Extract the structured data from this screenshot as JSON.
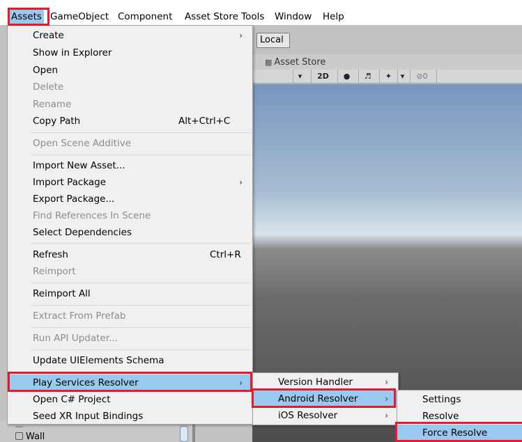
{
  "menubar": {
    "items": [
      "Assets",
      "GameObject",
      "Component",
      "Asset Store Tools",
      "Window",
      "Help"
    ]
  },
  "editor": {
    "local_button": "Local",
    "asset_store_tab": "Asset Store",
    "toolbar": {
      "mode_2d": "2D",
      "hidden_count": "0"
    },
    "hierarchy_item": "Wall"
  },
  "assets_menu": {
    "items": [
      {
        "label": "Create",
        "submenu": true,
        "enabled": true
      },
      {
        "label": "Show in Explorer",
        "enabled": true
      },
      {
        "label": "Open",
        "enabled": true
      },
      {
        "label": "Delete",
        "enabled": false
      },
      {
        "label": "Rename",
        "enabled": false
      },
      {
        "label": "Copy Path",
        "shortcut": "Alt+Ctrl+C",
        "enabled": true
      },
      {
        "label": "Open Scene Additive",
        "enabled": false
      },
      {
        "label": "Import New Asset...",
        "enabled": true
      },
      {
        "label": "Import Package",
        "submenu": true,
        "enabled": true
      },
      {
        "label": "Export Package...",
        "enabled": true
      },
      {
        "label": "Find References In Scene",
        "enabled": false
      },
      {
        "label": "Select Dependencies",
        "enabled": true
      },
      {
        "label": "Refresh",
        "shortcut": "Ctrl+R",
        "enabled": true
      },
      {
        "label": "Reimport",
        "enabled": false
      },
      {
        "label": "Reimport All",
        "enabled": true
      },
      {
        "label": "Extract From Prefab",
        "enabled": false
      },
      {
        "label": "Run API Updater...",
        "enabled": false
      },
      {
        "label": "Update UIElements Schema",
        "enabled": true
      },
      {
        "label": "Play Services Resolver",
        "submenu": true,
        "enabled": true,
        "highlighted": true
      },
      {
        "label": "Open C# Project",
        "enabled": true
      },
      {
        "label": "Seed XR Input Bindings",
        "enabled": true
      }
    ]
  },
  "resolver_menu": {
    "items": [
      {
        "label": "Version Handler",
        "submenu": true
      },
      {
        "label": "Android Resolver",
        "submenu": true,
        "highlighted": true
      },
      {
        "label": "iOS Resolver",
        "submenu": true
      }
    ]
  },
  "android_menu": {
    "items": [
      {
        "label": "Settings"
      },
      {
        "label": "Resolve"
      },
      {
        "label": "Force Resolve",
        "highlighted": true
      }
    ]
  },
  "colors": {
    "highlight": "#99c9ef",
    "callout_red": "#e8192c",
    "menu_bg": "#f0f0f0",
    "disabled_text": "#8c8c8c"
  }
}
